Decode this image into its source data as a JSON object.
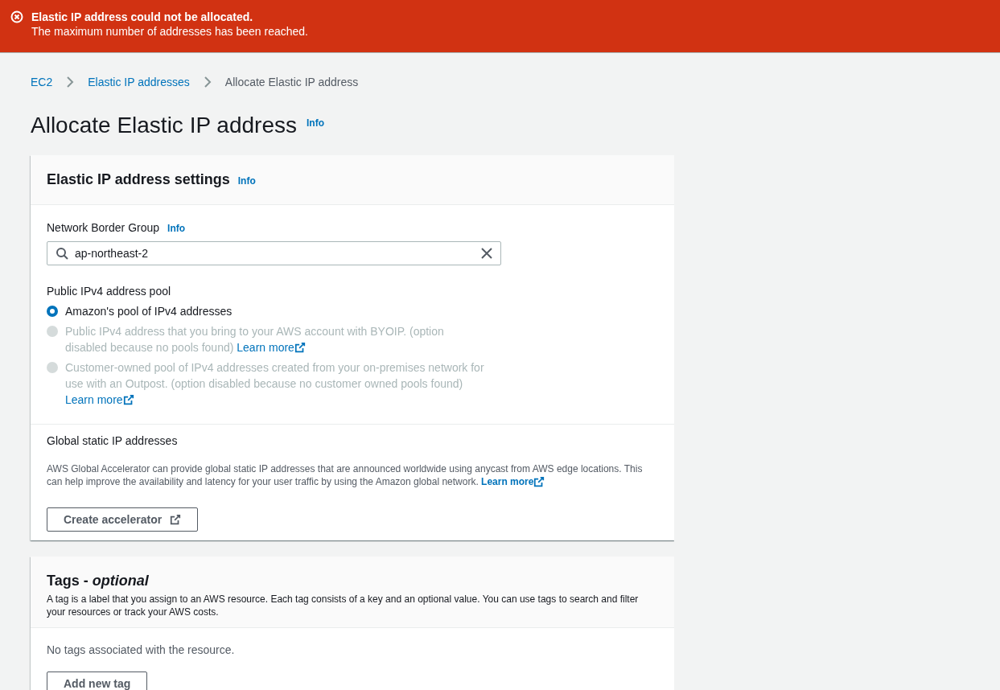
{
  "flash": {
    "title": "Elastic IP address could not be allocated.",
    "message": "The maximum number of addresses has been reached."
  },
  "breadcrumbs": [
    {
      "label": "EC2",
      "kind": "link"
    },
    {
      "label": "Elastic IP addresses",
      "kind": "link"
    },
    {
      "label": "Allocate Elastic IP address",
      "kind": "current"
    }
  ],
  "page": {
    "title": "Allocate Elastic IP address",
    "info": "Info"
  },
  "settings": {
    "title": "Elastic IP address settings",
    "info": "Info",
    "network_border_group": {
      "label": "Network Border Group",
      "info": "Info",
      "value": "ap-northeast-2"
    },
    "pool": {
      "label": "Public IPv4 address pool",
      "options": [
        {
          "label": "Amazon's pool of IPv4 addresses",
          "selected": true,
          "disabled": false
        },
        {
          "label": "Public IPv4 address that you bring to your AWS account with BYOIP. (option disabled because no pools found)",
          "link": "Learn more",
          "selected": false,
          "disabled": true
        },
        {
          "label": "Customer-owned pool of IPv4 addresses created from your on-premises network for use with an Outpost. (option disabled because no customer owned pools found)",
          "link": "Learn more",
          "selected": false,
          "disabled": true
        }
      ]
    },
    "global_static": {
      "title": "Global static IP addresses",
      "description": "AWS Global Accelerator can provide global static IP addresses that are announced worldwide using anycast from AWS edge locations. This can help improve the availability and latency for your user traffic by using the Amazon global network.",
      "link": "Learn more",
      "button": "Create accelerator"
    }
  },
  "tags": {
    "title": "Tags - *optional*",
    "description": "A tag is a label that you assign to an AWS resource. Each tag consists of a key and an optional value. You can use tags to search and filter your resources or track your AWS costs.",
    "empty": "No tags associated with the resource.",
    "button": "Add new tag"
  }
}
